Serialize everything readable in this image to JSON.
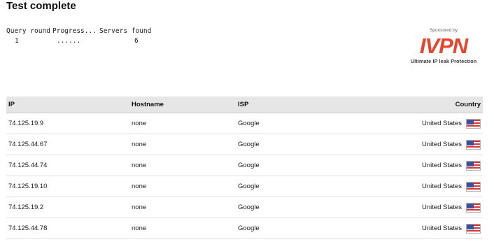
{
  "page": {
    "title": "Test complete"
  },
  "query": {
    "headers": [
      "Query round",
      "Progress...",
      "Servers found"
    ],
    "values": [
      "1",
      "......",
      "6"
    ]
  },
  "sponsor": {
    "label": "Sponsored by",
    "logo_text": "IVPN",
    "tagline": "Ultimate IP leak Protection",
    "logo_color": "#e8452f"
  },
  "table": {
    "columns": [
      "IP",
      "Hostname",
      "ISP",
      "Country"
    ],
    "rows": [
      {
        "ip": "74.125.19.9",
        "hostname": "none",
        "isp": "Google",
        "country": "United States",
        "flag_icon": "us-flag-icon"
      },
      {
        "ip": "74.125.44.67",
        "hostname": "none",
        "isp": "Google",
        "country": "United States",
        "flag_icon": "us-flag-icon"
      },
      {
        "ip": "74.125.44.74",
        "hostname": "none",
        "isp": "Google",
        "country": "United States",
        "flag_icon": "us-flag-icon"
      },
      {
        "ip": "74.125.19.10",
        "hostname": "none",
        "isp": "Google",
        "country": "United States",
        "flag_icon": "us-flag-icon"
      },
      {
        "ip": "74.125.19.2",
        "hostname": "none",
        "isp": "Google",
        "country": "United States",
        "flag_icon": "us-flag-icon"
      },
      {
        "ip": "74.125.44.78",
        "hostname": "none",
        "isp": "Google",
        "country": "United States",
        "flag_icon": "us-flag-icon"
      }
    ]
  }
}
